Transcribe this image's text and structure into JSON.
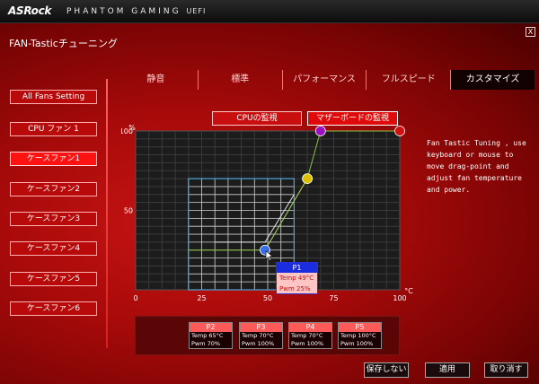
{
  "brand": {
    "name": "ASRock",
    "product": "PHANTOM GAMING",
    "suffix": "UEFI"
  },
  "window": {
    "title": "FAN-Tasticチューニング",
    "close": "X"
  },
  "tabs": [
    {
      "label": "静音",
      "active": false
    },
    {
      "label": "標準",
      "active": false
    },
    {
      "label": "パフォーマンス",
      "active": false
    },
    {
      "label": "フルスピード",
      "active": false
    },
    {
      "label": "カスタマイズ",
      "active": true
    }
  ],
  "sidebar": [
    {
      "label": "All Fans Setting",
      "active": false
    },
    {
      "label": "CPU ファン 1",
      "active": false
    },
    {
      "label": "ケースファン1",
      "active": true
    },
    {
      "label": "ケースファン2",
      "active": false
    },
    {
      "label": "ケースファン3",
      "active": false
    },
    {
      "label": "ケースファン4",
      "active": false
    },
    {
      "label": "ケースファン5",
      "active": false
    },
    {
      "label": "ケースファン6",
      "active": false
    }
  ],
  "monitor": {
    "cpu_label": "CPUの監視",
    "mb_label": "マザーボードの監視",
    "selected": "mb"
  },
  "help_text": "Fan Tastic Tuning , use keyboard or mouse to move drag-point and adjust fan temperature and power.",
  "chart_data": {
    "type": "line",
    "x_unit": "°C",
    "y_unit": "%",
    "xlim": [
      0,
      100
    ],
    "ylim": [
      0,
      100
    ],
    "x_ticks": [
      0,
      25,
      50,
      75,
      100
    ],
    "y_ticks": [
      50,
      100
    ],
    "grid": true,
    "series": [
      {
        "points": [
          [
            49,
            25
          ],
          [
            65,
            70
          ],
          [
            70,
            100
          ],
          [
            100,
            100
          ]
        ]
      }
    ],
    "colors": {
      "background": "#1c1c1c",
      "grid": "#3a3a3a",
      "highlight_grid": "#c8c8c8",
      "highlight_border": "#4aa8d8",
      "p1": "#3a6ee8",
      "p2": "#ddc000",
      "p3": "#9a10c0",
      "p4": "#d01010",
      "curve": "#8ec23e"
    }
  },
  "popup": {
    "name": "P1",
    "temp": "Temp 49°C",
    "pwm": "Pwm 25%"
  },
  "points": [
    {
      "name": "P2",
      "temp": "Temp 65°C",
      "pwm": "Pwm  70%"
    },
    {
      "name": "P3",
      "temp": "Temp 70°C",
      "pwm": "Pwm  100%"
    },
    {
      "name": "P4",
      "temp": "Temp 70°C",
      "pwm": "Pwm  100%"
    },
    {
      "name": "P5",
      "temp": "Temp 100°C",
      "pwm": "Pwm  100%"
    }
  ],
  "actions": {
    "discard": "保存しない",
    "apply": "適用",
    "cancel": "取り消す"
  }
}
